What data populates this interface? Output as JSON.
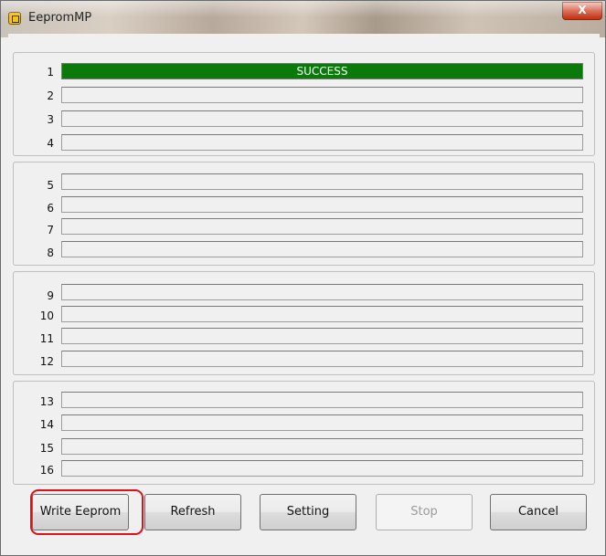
{
  "window": {
    "title": "EepromMP",
    "close_label": "X"
  },
  "slots": [
    {
      "num": "1",
      "status": "SUCCESS"
    },
    {
      "num": "2",
      "status": ""
    },
    {
      "num": "3",
      "status": ""
    },
    {
      "num": "4",
      "status": ""
    },
    {
      "num": "5",
      "status": ""
    },
    {
      "num": "6",
      "status": ""
    },
    {
      "num": "7",
      "status": ""
    },
    {
      "num": "8",
      "status": ""
    },
    {
      "num": "9",
      "status": ""
    },
    {
      "num": "10",
      "status": ""
    },
    {
      "num": "11",
      "status": ""
    },
    {
      "num": "12",
      "status": ""
    },
    {
      "num": "13",
      "status": ""
    },
    {
      "num": "14",
      "status": ""
    },
    {
      "num": "15",
      "status": ""
    },
    {
      "num": "16",
      "status": ""
    }
  ],
  "buttons": {
    "write": "Write Eeprom",
    "refresh": "Refresh",
    "setting": "Setting",
    "stop": "Stop",
    "cancel": "Cancel"
  },
  "colors": {
    "success": "#0a7a0a",
    "highlight": "#e0101a"
  }
}
